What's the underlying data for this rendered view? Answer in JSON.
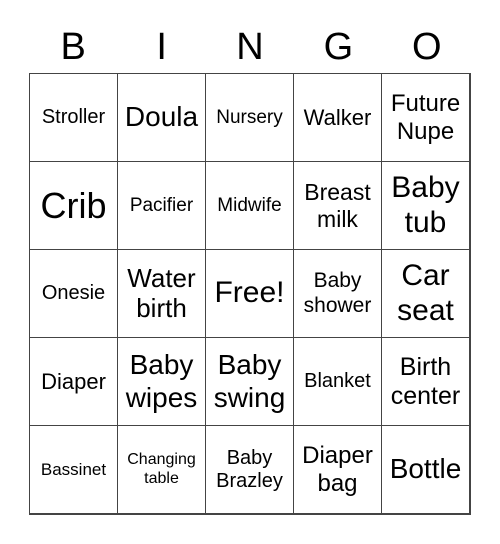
{
  "header": [
    "B",
    "I",
    "N",
    "G",
    "O"
  ],
  "cells": [
    [
      "Stroller",
      "Doula",
      "Nursery",
      "Walker",
      "Future Nupe"
    ],
    [
      "Crib",
      "Pacifier",
      "Midwife",
      "Breast milk",
      "Baby tub"
    ],
    [
      "Onesie",
      "Water birth",
      "Free!",
      "Baby shower",
      "Car seat"
    ],
    [
      "Diaper",
      "Baby wipes",
      "Baby swing",
      "Blanket",
      "Birth center"
    ],
    [
      "Bassinet",
      "Changing table",
      "Baby Brazley",
      "Diaper bag",
      "Bottle"
    ]
  ]
}
